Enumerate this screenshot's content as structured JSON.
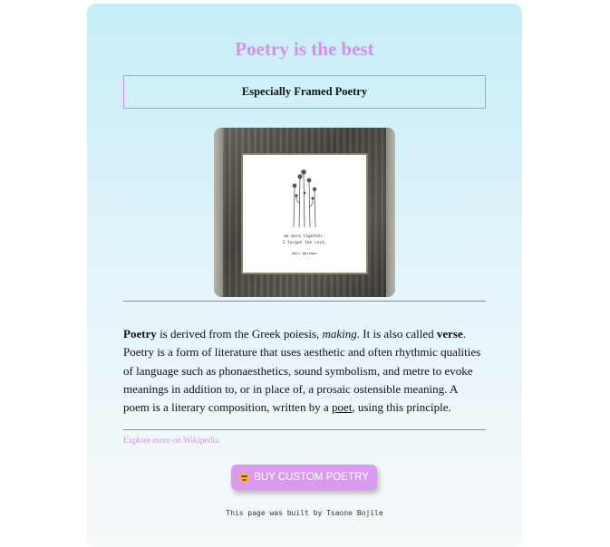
{
  "header": {
    "title": "Poetry is the best",
    "subtitle": "Especially Framed Poetry"
  },
  "image": {
    "poem_line_1": "we were together.",
    "poem_line_2": "I forget the rest.",
    "poem_author": "Walt Whitman"
  },
  "article": {
    "term": "Poetry",
    "part1": " is derived from the Greek poiesis, ",
    "making": "making",
    "part2": ". It is also called ",
    "verse": "verse",
    "part3": ". Poetry is a form of literature that uses aesthetic and often rhythmic qualities of language such as phonaesthetics, sound symbolism, and metre to evoke meanings in addition to, or in place of, a prosaic ostensible meaning. A poem is a literary composition, written by a ",
    "poet_link": "poet",
    "part4": ", using this principle."
  },
  "links": {
    "wikipedia": "Explore more on Wikipedia"
  },
  "cta": {
    "label": "BUY CUSTOM POETRY",
    "icon": "grinning-face-icon"
  },
  "footer": {
    "text": "This page was built by Tsaone Bojile"
  },
  "colors": {
    "accent": "#d58ee9",
    "button": "#d99af0",
    "border": "#c88ef0"
  }
}
